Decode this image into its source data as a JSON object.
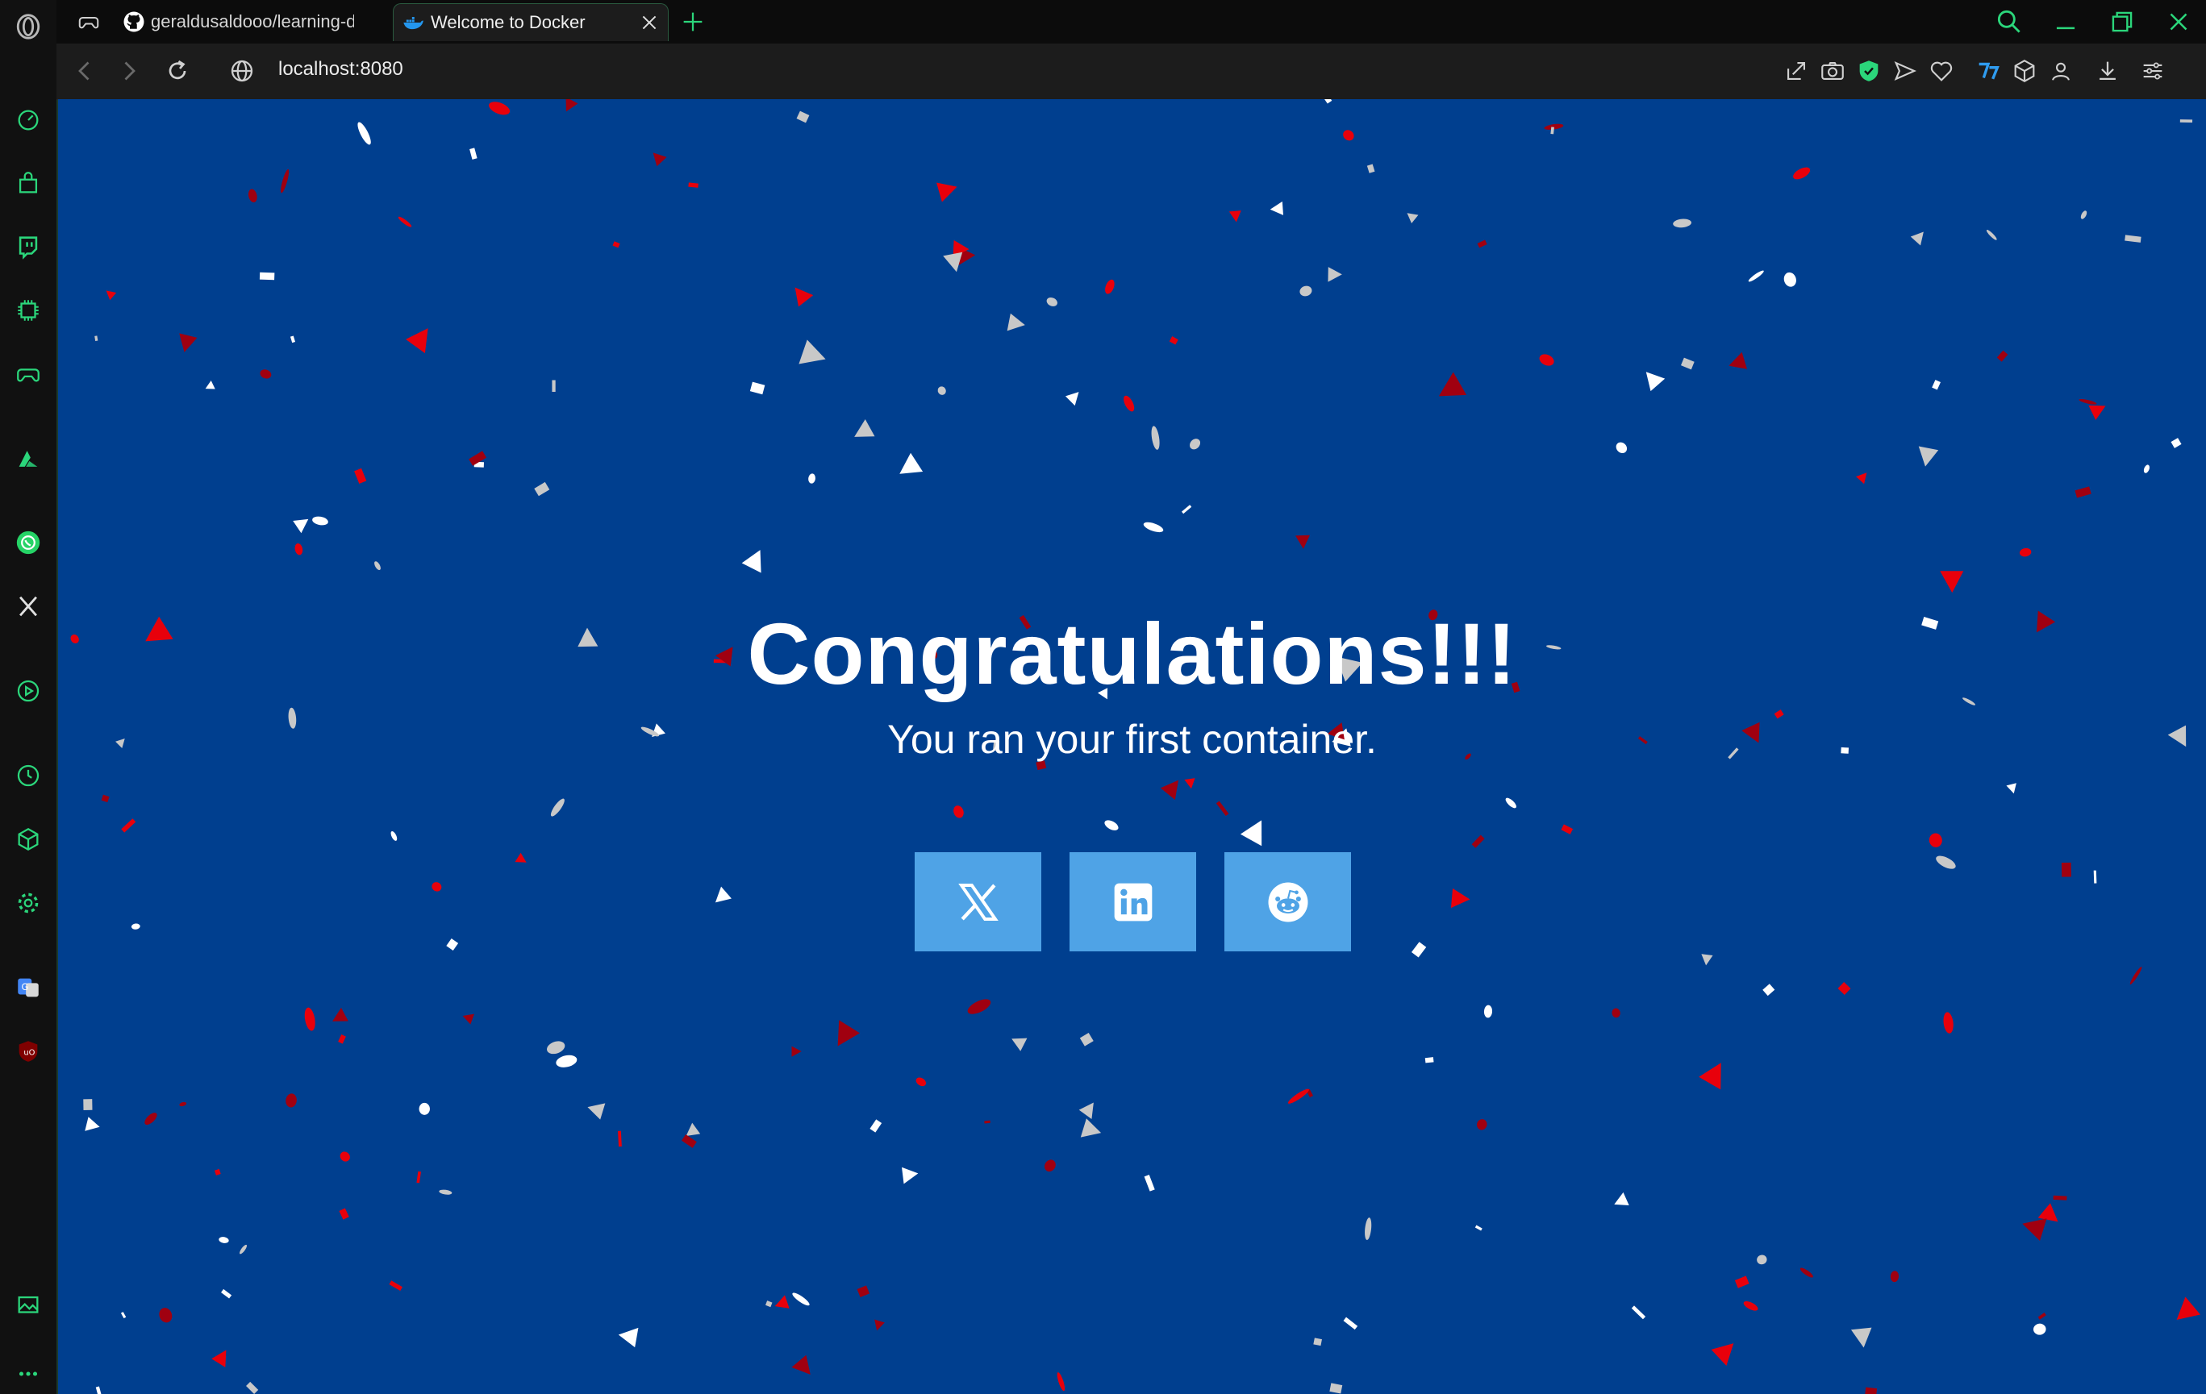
{
  "browser": {
    "tabs": [
      {
        "label": "geraldusaldooo/learning-d",
        "icon": "github-icon",
        "active": false
      },
      {
        "label": "Welcome to Docker",
        "icon": "docker-icon",
        "active": true
      }
    ],
    "address": "localhost:8080"
  },
  "sidebar": {
    "items": [
      {
        "icon": "speed-dial-icon"
      },
      {
        "icon": "shopping-bag-icon"
      },
      {
        "icon": "twitch-icon"
      },
      {
        "icon": "ai-chip-icon"
      },
      {
        "icon": "gamepad-icon"
      },
      {
        "icon": "aria-icon"
      },
      {
        "icon": "whatsapp-icon"
      },
      {
        "icon": "x-icon"
      },
      {
        "icon": "player-icon"
      },
      {
        "icon": "history-icon"
      },
      {
        "icon": "extensions-icon"
      },
      {
        "icon": "settings-icon"
      },
      {
        "icon": "translate-icon"
      },
      {
        "icon": "ublock-icon"
      },
      {
        "icon": "gallery-icon"
      },
      {
        "icon": "more-icon"
      }
    ]
  },
  "page": {
    "headline": "Congratulations!!!",
    "subline": "You ran your first container.",
    "share_buttons": [
      {
        "icon": "x-icon"
      },
      {
        "icon": "linkedin-icon"
      },
      {
        "icon": "reddit-icon"
      }
    ]
  },
  "colors": {
    "page_bg": "#003f8f",
    "button_bg": "#4fa3e6",
    "confetti": [
      "#ffffff",
      "#c8c8c8",
      "#e8000b",
      "#a00010"
    ],
    "accent": "#2bd67b"
  }
}
